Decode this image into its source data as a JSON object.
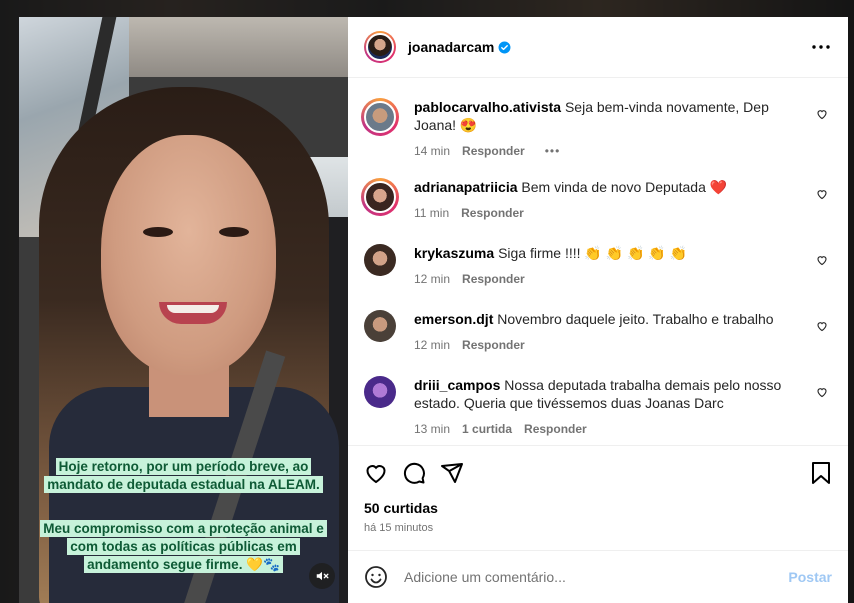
{
  "post": {
    "username": "joanadarcam",
    "caption_line1": "Hoje retorno, por um período breve, ao mandato de deputada estadual na ALEAM.",
    "caption_line2": "Meu compromisso com a proteção animal e com todas as políticas públicas em andamento segue firme. 💛🐾",
    "likes": "50 curtidas",
    "time": "há 15 minutos"
  },
  "comments": [
    {
      "user": "pablocarvalho.ativista",
      "text": "Seja bem-vinda novamente, Dep Joana! 😍",
      "time": "14 min",
      "reply": "Responder",
      "likes": "",
      "more": "•••"
    },
    {
      "user": "adrianapatriicia",
      "text": "Bem vinda de novo Deputada ❤️",
      "time": "11 min",
      "reply": "Responder",
      "likes": ""
    },
    {
      "user": "krykaszuma",
      "text": "Siga firme !!!! 👏 👏 👏 👏 👏",
      "time": "12 min",
      "reply": "Responder",
      "likes": ""
    },
    {
      "user": "emerson.djt",
      "text": "Novembro daquele jeito. Trabalho e trabalho",
      "time": "12 min",
      "reply": "Responder",
      "likes": ""
    },
    {
      "user": "driii_campos",
      "text": "Nossa deputada trabalha demais pelo nosso estado. Queria que tivéssemos duas Joanas Darc",
      "time": "13 min",
      "reply": "Responder",
      "likes": "1 curtida"
    }
  ],
  "add_comment": {
    "placeholder": "Adicione um comentário...",
    "post_label": "Postar"
  },
  "colors": {
    "caption_bg": "#c7f2da",
    "caption_text": "#0e5a35",
    "verified": "#0095f6",
    "post_button": "#9fc8f4"
  }
}
